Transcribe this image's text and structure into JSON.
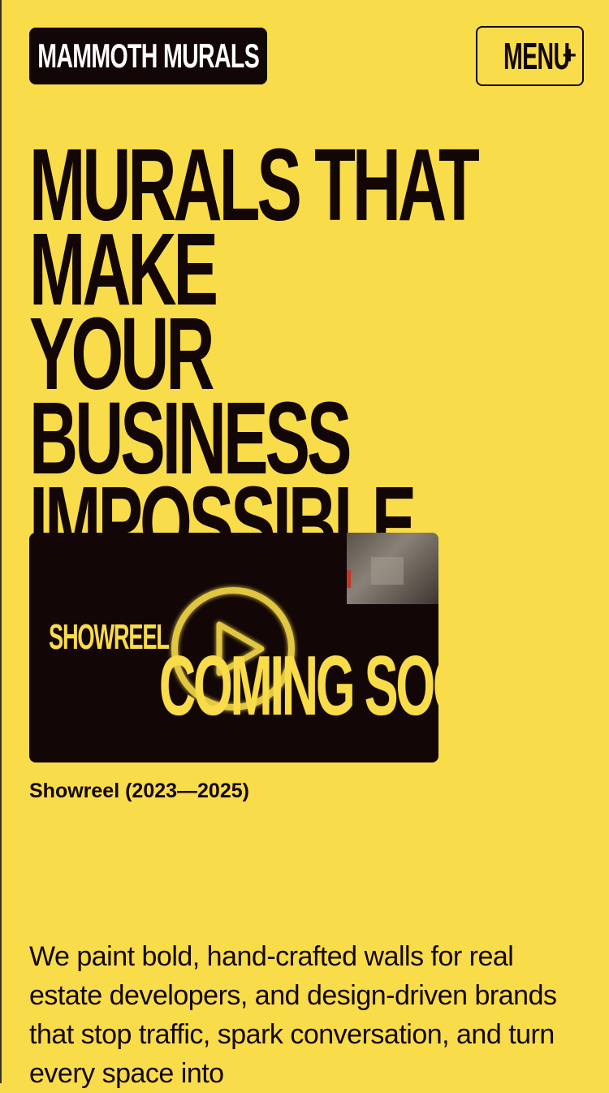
{
  "header": {
    "logo_text": "MAMMOTH MURALS",
    "menu_label": "MENU",
    "menu_icon": "+"
  },
  "hero": {
    "headline": "MURALS THAT MAKE\nYOUR BUSINESS\nIMPOSSIBLE TO\nIGNORE."
  },
  "video": {
    "label": "SHOWREEL",
    "status": "COMING SOON",
    "play_icon": "play-icon",
    "caption": "Showreel (2023—2025)"
  },
  "intro": {
    "text": "We paint bold, hand-crafted walls for real estate developers, and design-driven brands that stop traffic, spark conversation, and turn every space into"
  },
  "colors": {
    "background": "#f9dc4a",
    "ink": "#120606",
    "accent": "#f9dc4a"
  }
}
